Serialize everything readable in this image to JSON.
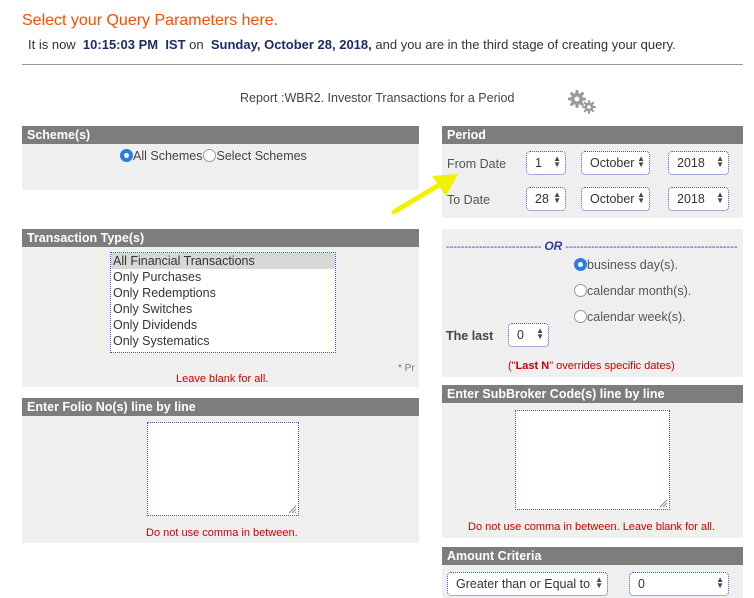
{
  "header": {
    "title": "Select your Query Parameters here.",
    "status_prefix": "It is now",
    "time": "10:15:03 PM",
    "timezone": "IST",
    "on": "on",
    "date": "Sunday, October 28, 2018,",
    "status_suffix": "and you are in the third stage of creating your query."
  },
  "report": {
    "label": "Report :WBR2. Investor Transactions for a Period"
  },
  "scheme": {
    "heading": "Scheme(s)",
    "options": [
      "All Schemes",
      "Select Schemes"
    ],
    "selected": "All Schemes"
  },
  "transaction": {
    "heading": "Transaction Type(s)",
    "items": [
      "All Financial Transactions",
      "Only Purchases",
      "Only Redemptions",
      "Only Switches",
      "Only Dividends",
      "Only Systematics"
    ],
    "selected": "All Financial Transactions",
    "note": "Leave blank for all.",
    "side_note": "* Pr"
  },
  "folio": {
    "heading": "Enter Folio No(s) line by line",
    "note": "Do not use comma in between."
  },
  "period": {
    "heading": "Period",
    "from_label": "From Date",
    "to_label": "To Date",
    "from": {
      "day": "1",
      "month": "October",
      "year": "2018"
    },
    "to": {
      "day": "28",
      "month": "October",
      "year": "2018"
    }
  },
  "or_section": {
    "divider_left": "--------------------------",
    "or_label": "OR",
    "divider_right": "--------------------------------------------------",
    "options": [
      "business day(s).",
      "calendar month(s).",
      "calendar week(s)."
    ],
    "selected": "business day(s).",
    "last_label": "The last",
    "last_value": "0",
    "note_prefix": "(\"",
    "note_bold": "Last N",
    "note_suffix": "\" overrides specific dates)"
  },
  "subbroker": {
    "heading": "Enter SubBroker Code(s) line by line",
    "note": "Do not use comma in between. Leave blank for all."
  },
  "amount": {
    "heading": "Amount Criteria",
    "operator": "Greater than or Equal to",
    "value": "0"
  },
  "colors": {
    "accent": "#ff4a00",
    "panel_header": "#7d7d7d",
    "panel_bg": "#efefef",
    "note_red": "#cc0000",
    "arrow": "#f2f200"
  }
}
